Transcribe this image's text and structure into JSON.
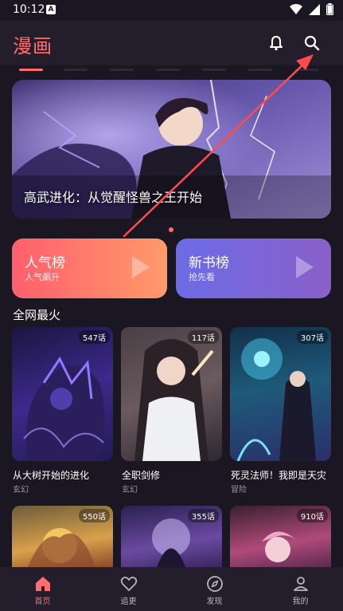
{
  "status": {
    "time": "10:12",
    "notification_icon": "A"
  },
  "header": {
    "title": "漫画"
  },
  "banner": {
    "caption": "高武进化：从觉醒怪兽之王开始"
  },
  "rank_cards": [
    {
      "title": "人气榜",
      "subtitle": "人气飙升"
    },
    {
      "title": "新书榜",
      "subtitle": "抢先看"
    }
  ],
  "section": {
    "title": "全网最火"
  },
  "comics": [
    {
      "title": "从大树开始的进化",
      "genre": "玄幻",
      "episodes": "547话"
    },
    {
      "title": "全职剑修",
      "genre": "玄幻",
      "episodes": "117话"
    },
    {
      "title": "死灵法师！我即是天灾",
      "genre": "冒险",
      "episodes": "307话"
    },
    {
      "episodes": "550话"
    },
    {
      "episodes": "355话"
    },
    {
      "episodes": "910话"
    }
  ],
  "nav": [
    {
      "label": "首页",
      "icon": "home-icon",
      "active": true
    },
    {
      "label": "追更",
      "icon": "heart-icon",
      "active": false
    },
    {
      "label": "发现",
      "icon": "compass-icon",
      "active": false
    },
    {
      "label": "我的",
      "icon": "user-icon",
      "active": false
    }
  ],
  "colors": {
    "accent": "#ff6d6d",
    "background": "#1b1722",
    "header": "#231d2c"
  }
}
